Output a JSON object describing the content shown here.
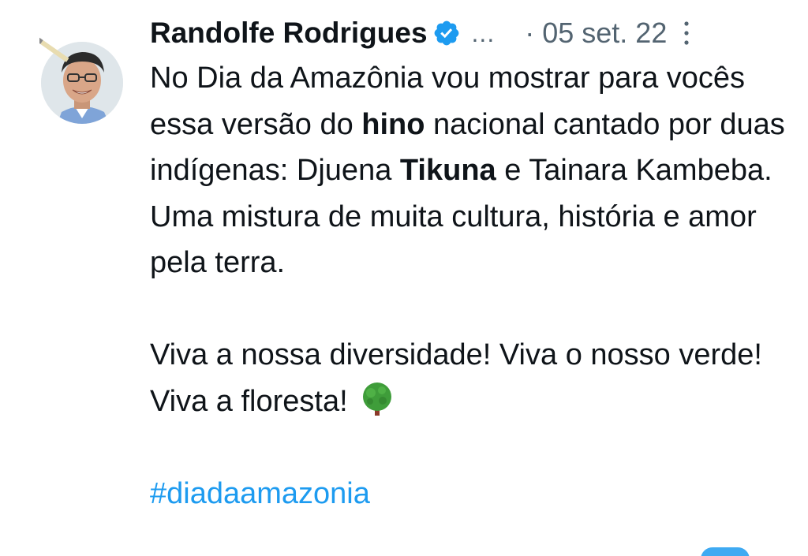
{
  "tweet": {
    "author_name": "Randolfe Rodrigues",
    "truncation": "...",
    "separator": "·",
    "timestamp": "05 set. 22",
    "icons": {
      "avatar": "avatar",
      "verified": "verified-badge-icon",
      "more": "more-options-icon",
      "tree": "deciduous-tree-emoji-icon"
    },
    "colors": {
      "verified": "#1d9bf0",
      "hashtag": "#1d9bf0",
      "muted": "#536471",
      "text": "#0f1419"
    },
    "body": {
      "p1_part1": "No Dia da Amazônia vou mostrar para vocês essa versão do ",
      "p1_bold1": "hino",
      "p1_part2": " nacional cantado por duas indígenas: Djuena ",
      "p1_bold2": "Tikuna",
      "p1_part3": " e Tainara Kambeba. Uma mistura de muita cultura, história e amor pela terra.",
      "p2": "Viva a nossa diversidade! Viva o nosso verde! Viva a floresta! ",
      "hashtag": "#diadaamazonia"
    }
  }
}
